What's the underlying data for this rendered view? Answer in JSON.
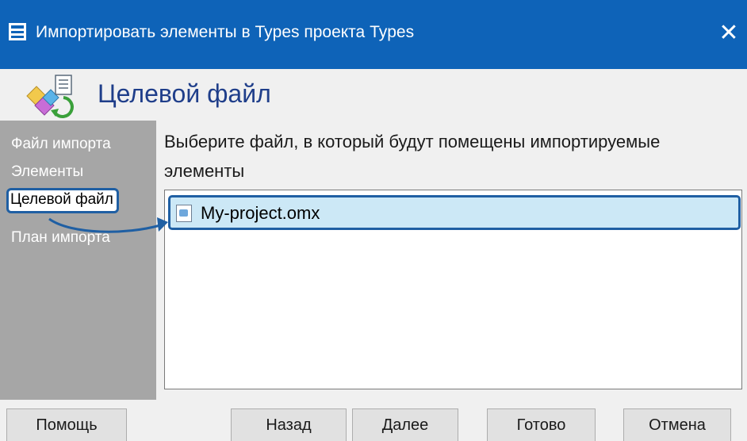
{
  "window": {
    "title": "Импортировать элементы в Types проекта Types",
    "close_glyph": "✕"
  },
  "header": {
    "title": "Целевой файл",
    "icon": "import-wizard-icon"
  },
  "steps": [
    {
      "label": "Файл импорта",
      "active": false
    },
    {
      "label": "Элементы",
      "active": false
    },
    {
      "label": "Целевой файл",
      "active": true
    },
    {
      "label": "План импорта",
      "active": false
    }
  ],
  "main": {
    "prompt": "Выберите файл, в который будут помещены импортируемые элементы",
    "files": [
      {
        "name": "My-project.omx",
        "icon": "omx-file-icon",
        "selected": true
      }
    ]
  },
  "buttons": {
    "help": "Помощь",
    "back": "Назад",
    "next": "Далее",
    "finish": "Готово",
    "cancel": "Отмена"
  },
  "colors": {
    "titlebar": "#0e63b8",
    "header_title": "#1f3e8a",
    "steps_panel": "#a6a6a6",
    "selection": "#cce8f6",
    "highlight": "#1f5fa3"
  }
}
